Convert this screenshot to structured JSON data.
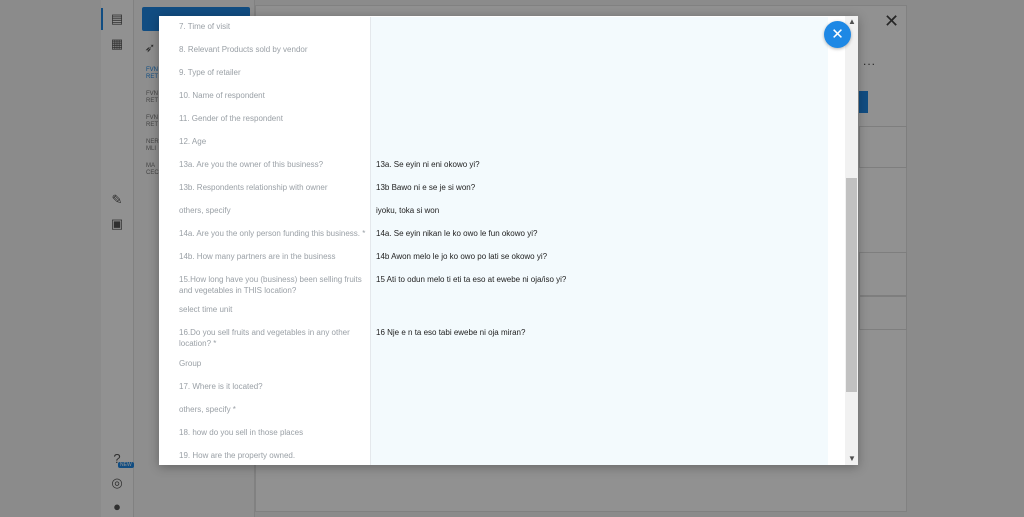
{
  "background": {
    "sidebar_items": [
      {
        "label": "FVN RET"
      },
      {
        "label": "FVN RET"
      },
      {
        "label": "FVN RET"
      },
      {
        "label": "NER MLI"
      },
      {
        "label": "MA CEC"
      }
    ],
    "help_badge": "NEW",
    "more_label": "...",
    "close_label": "✕"
  },
  "modal": {
    "close_label": "✕",
    "rows": [
      {
        "question": "7. Time of visit",
        "answer": ""
      },
      {
        "question": "8. Relevant Products sold by vendor",
        "answer": ""
      },
      {
        "question": "9. Type of retailer",
        "answer": ""
      },
      {
        "question": "10. Name of respondent",
        "answer": ""
      },
      {
        "question": "11. Gender of the respondent",
        "answer": ""
      },
      {
        "question": "12. Age",
        "answer": ""
      },
      {
        "question": "13a. Are you the owner of this business?",
        "answer": "13a. Se eyin ni eni okowo yi?"
      },
      {
        "question": "13b. Respondents relationship with owner",
        "answer": "13b Bawo ni e se je si won?"
      },
      {
        "question": "others, specify",
        "answer": "iyoku, toka si won"
      },
      {
        "question": "14a. Are you the only person funding this business. *",
        "answer": "14a. Se eyin nikan le ko owo le fun okowo yi?"
      },
      {
        "question": "14b. How many partners are in the business",
        "answer": "14b Awon melo le jo ko owo po lati se okowo yi?"
      },
      {
        "question": "15.How long have you (business) been selling fruits and vegetables in THIS location?",
        "answer": "15 Ati to odun melo ti eti ta eso at ewebe ni oja/iso yi?"
      },
      {
        "question": "select time unit",
        "answer": ""
      },
      {
        "question": "16.Do you sell fruits and vegetables in any other location? *",
        "answer": "16 Nje e n ta eso tabi ewebe ni oja miran?"
      },
      {
        "question": "Group",
        "answer": ""
      },
      {
        "question": "17. Where is it located?",
        "answer": ""
      },
      {
        "question": "others, specify *",
        "answer": ""
      },
      {
        "question": "18. how do you sell in those places",
        "answer": ""
      },
      {
        "question": "19. How are the property owned.",
        "answer": ""
      }
    ]
  }
}
